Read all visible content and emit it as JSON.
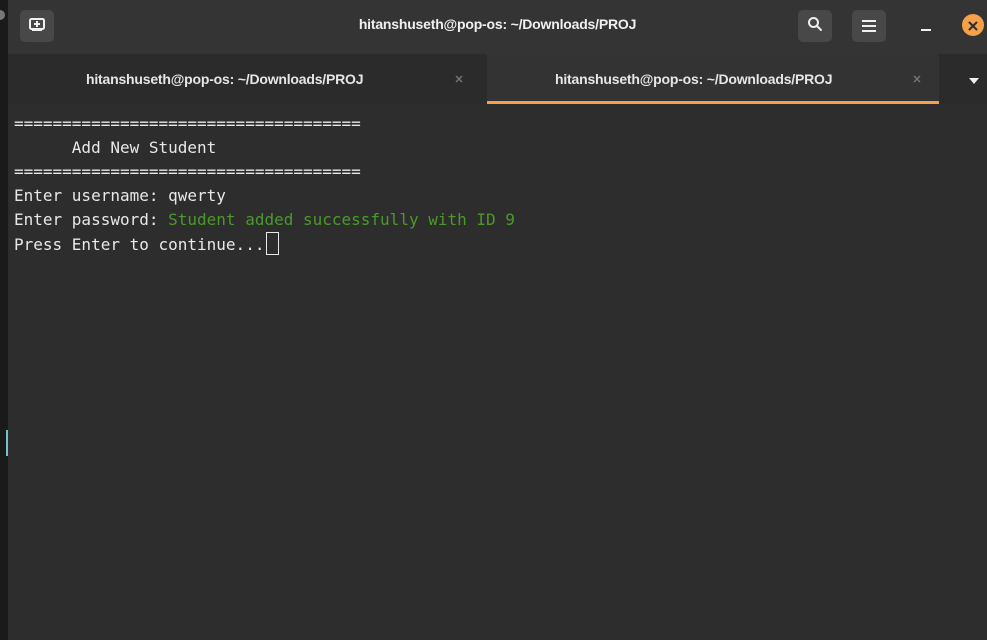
{
  "window": {
    "title": "hitanshuseth@pop-os: ~/Downloads/PROJ"
  },
  "headerbar": {
    "new_tab_icon": "new-tab-icon",
    "search_icon": "search-icon",
    "menu_icon": "hamburger-menu-icon",
    "minimize_icon": "minimize-icon",
    "close_icon": "close-icon",
    "close_color": "#f6a04a"
  },
  "tabs": [
    {
      "label": "hitanshuseth@pop-os: ~/Downloads/PROJ",
      "active": false
    },
    {
      "label": "hitanshuseth@pop-os: ~/Downloads/PROJ",
      "active": true
    }
  ],
  "terminal": {
    "lines": [
      "====================================",
      "      Add New Student",
      "====================================",
      "Enter username: qwerty"
    ],
    "password_prompt": "Enter password: ",
    "success_message": "Student added successfully with ID 9",
    "continue_prompt": "Press Enter to continue...",
    "success_color": "#4a9a2a",
    "background_color": "#2d2d2d"
  }
}
